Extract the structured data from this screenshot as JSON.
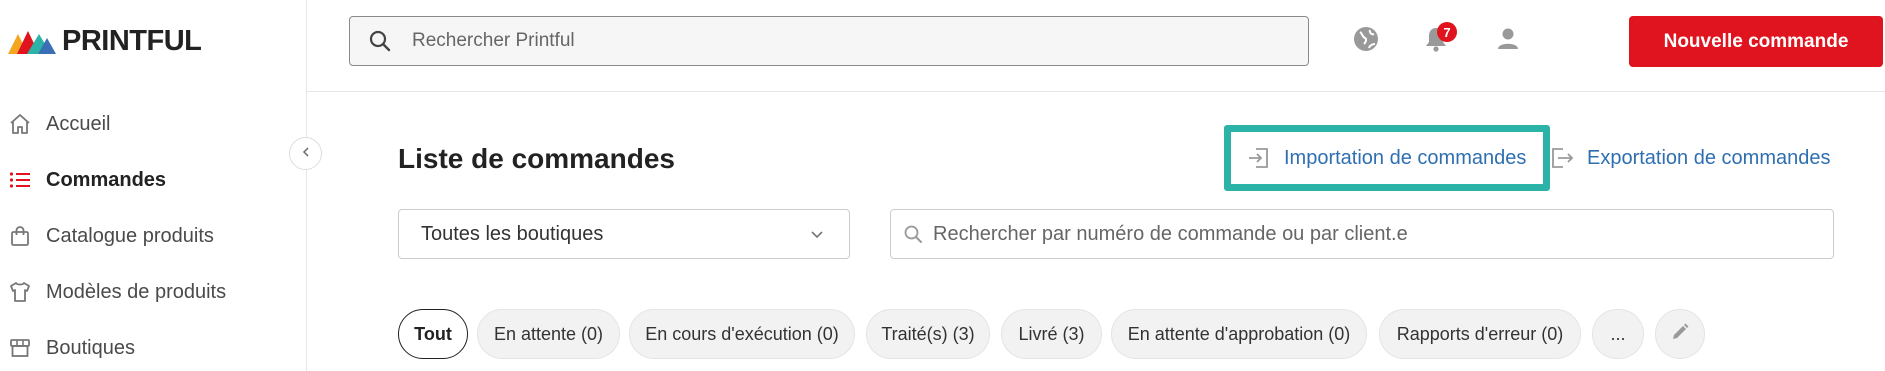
{
  "brand": {
    "name": "PRINTFUL"
  },
  "sidebar": {
    "items": [
      {
        "label": "Accueil",
        "icon": "home-icon"
      },
      {
        "label": "Commandes",
        "icon": "list-icon",
        "active": true
      },
      {
        "label": "Catalogue produits",
        "icon": "shopping-bag-icon"
      },
      {
        "label": "Modèles de produits",
        "icon": "tshirt-icon"
      },
      {
        "label": "Boutiques",
        "icon": "store-icon"
      }
    ]
  },
  "header": {
    "search_placeholder": "Rechercher Printful",
    "notification_count": "7",
    "new_order_label": "Nouvelle commande"
  },
  "main": {
    "title": "Liste de commandes",
    "import_label": "Importation de commandes",
    "export_label": "Exportation de commandes",
    "store_select_value": "Toutes les boutiques",
    "order_search_placeholder": "Rechercher par numéro de commande ou par client.e",
    "filters": [
      "Tout",
      "En attente (0)",
      "En cours d'exécution (0)",
      "Traité(s) (3)",
      "Livré (3)",
      "En attente d'approbation (0)",
      "Rapports d'erreur (0)",
      "..."
    ]
  },
  "colors": {
    "accent": "#e0141e",
    "link": "#2f6fb0",
    "highlight": "#2bb3a8"
  }
}
